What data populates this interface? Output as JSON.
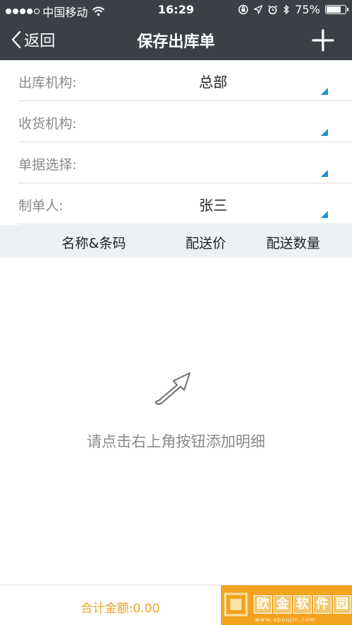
{
  "status_bar": {
    "carrier": "中国移动",
    "time": "16:29",
    "battery": "75%",
    "battery_level": 0.75
  },
  "nav": {
    "back_label": "返回",
    "title": "保存出库单"
  },
  "form": {
    "rows": [
      {
        "label": "出库机构:",
        "value": "总部"
      },
      {
        "label": "收货机构:",
        "value": ""
      },
      {
        "label": "单据选择:",
        "value": ""
      },
      {
        "label": "制单人:",
        "value": "张三"
      }
    ]
  },
  "table": {
    "columns": [
      "名称&条码",
      "配送价",
      "配送数量"
    ]
  },
  "empty_state": {
    "message": "请点击右上角按钮添加明细"
  },
  "footer": {
    "total_label": "合计金额:0.00"
  },
  "watermark": {
    "chars": [
      "欧",
      "金",
      "软",
      "件",
      "园"
    ],
    "url": "www.apoujin.com"
  },
  "colors": {
    "header_bg": "#3c4046",
    "accent_orange": "#f4a21f",
    "corner_blue": "#1e90d6"
  }
}
